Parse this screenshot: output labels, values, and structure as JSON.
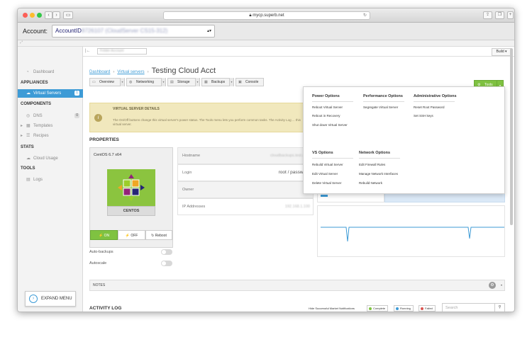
{
  "browser": {
    "url": "mycp.superb.net"
  },
  "account": {
    "label": "Account:",
    "value_prefix": "AccountID",
    "value_redacted": "8726107 (CloudServer CS15-312)"
  },
  "topbar": {
    "folder_placeholder": "Folder Account",
    "build_label": "Build"
  },
  "sidebar": {
    "dashboard": "Dashboard",
    "appliances_header": "APPLIANCES",
    "virtual_servers": "Virtual Servers",
    "virtual_servers_count": "1",
    "components_header": "COMPONENTS",
    "dns": "DNS",
    "dns_count": "0",
    "templates": "Templates",
    "recipes": "Recipes",
    "stats_header": "STATS",
    "cloud_usage": "Cloud Usage",
    "tools_header": "TOOLS",
    "logs": "Logs",
    "expand_menu": "EXPAND MENU"
  },
  "breadcrumb": {
    "dashboard": "Dashboard",
    "virtual_servers": "Virtual servers",
    "current": "Testing Cloud Acct"
  },
  "tabs": {
    "overview": "Overview",
    "networking": "Networking",
    "storage": "Storage",
    "backups": "Backups",
    "console": "Console"
  },
  "tools_button": "Tools",
  "notice": {
    "title": "VIRTUAL SERVER DETAILS",
    "body": "The On/Off buttons change this virtual server's power status. The Tools menu lets you perform common tasks. The Activity Log ... this virtual server."
  },
  "properties_header": "PROPERTIES",
  "os": {
    "title": "CentOS 6.7 x64",
    "name": "CENTOS",
    "on": "ON",
    "off": "OFF",
    "reboot": "Reboot"
  },
  "toggles": {
    "auto_backups": "Auto-backups",
    "autoscale": "Autoscale"
  },
  "info": {
    "hostname_label": "Hostname",
    "hostname_value": "cloudbackups.test.com",
    "login_label": "Login",
    "login_value": "root / password",
    "owner_label": "Owner",
    "ip_label": "IP Addresses",
    "ip_value": "192.168.1.100"
  },
  "notes_label": "NOTES",
  "activity": {
    "header": "ACTIVITY LOG",
    "hide_label": "Hide Successful Market Notifications",
    "complete": "Complete",
    "running": "Running",
    "failed": "Failed",
    "search_placeholder": "Search"
  },
  "tools_menu": {
    "power_header": "Power Options",
    "power_items": [
      "Reboot Virtual Server",
      "Reboot in Recovery",
      "Shut down Virtual Server"
    ],
    "perf_header": "Performance Options",
    "perf_items": [
      "Segregate Virtual Server"
    ],
    "admin_header": "Administrative Options",
    "admin_items": [
      "Reset Root Password",
      "Set SSH keys"
    ],
    "vs_header": "VS Options",
    "vs_items": [
      "Rebuild Virtual Server",
      "Edit Virtual Server",
      "Delete Virtual Server"
    ],
    "net_header": "Network Options",
    "net_items": [
      "Edit Firewall Rules",
      "Manage Network Interfaces",
      "Rebuild Network"
    ]
  },
  "colors": {
    "accent": "#3d9bd6",
    "green": "#7fc241",
    "notice_bg": "#f1e8bd"
  }
}
